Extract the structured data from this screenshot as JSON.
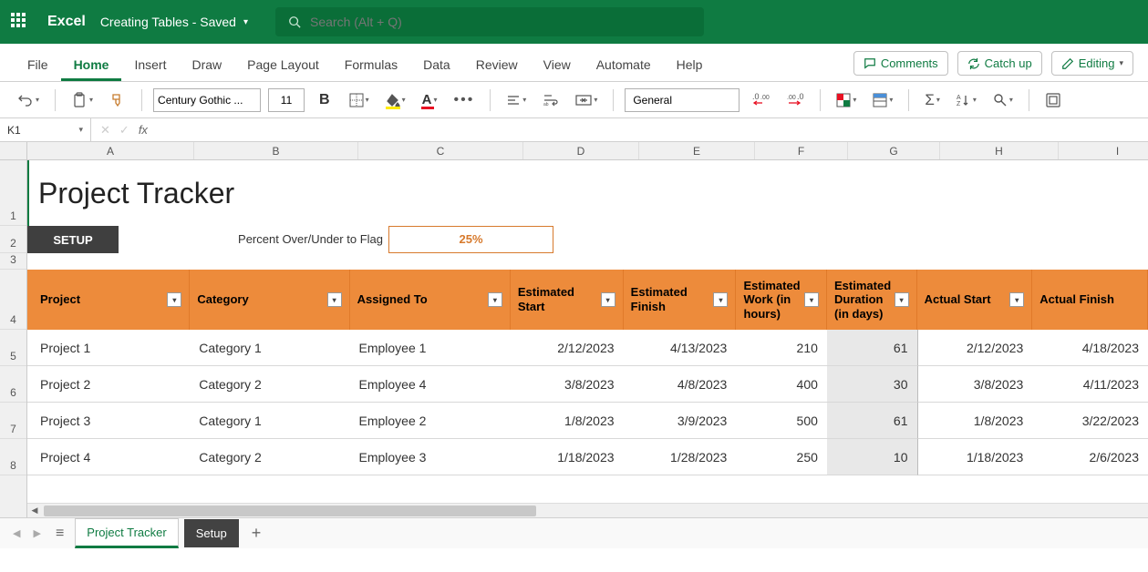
{
  "titlebar": {
    "app": "Excel",
    "doc": "Creating Tables - Saved",
    "search_placeholder": "Search (Alt + Q)"
  },
  "tabs": {
    "items": [
      "File",
      "Home",
      "Insert",
      "Draw",
      "Page Layout",
      "Formulas",
      "Data",
      "Review",
      "View",
      "Automate",
      "Help"
    ],
    "active": "Home",
    "comments": "Comments",
    "catchup": "Catch up",
    "editing": "Editing"
  },
  "ribbon": {
    "font_name": "Century Gothic ...",
    "font_size": "11",
    "number_format": "General"
  },
  "namebox": "K1",
  "columns": [
    "A",
    "B",
    "C",
    "D",
    "E",
    "F",
    "G",
    "H",
    "I"
  ],
  "rows": [
    "1",
    "2",
    "3",
    "4",
    "5",
    "6",
    "7",
    "8"
  ],
  "sheet": {
    "title": "Project Tracker",
    "setup": "SETUP",
    "flag_label": "Percent Over/Under to Flag",
    "flag_value": "25%"
  },
  "headers": [
    "Project",
    "Category",
    "Assigned To",
    "Estimated Start",
    "Estimated Finish",
    "Estimated Work (in hours)",
    "Estimated Duration (in days)",
    "Actual Start",
    "Actual Finish"
  ],
  "data_rows": [
    {
      "project": "Project 1",
      "category": "Category 1",
      "assigned": "Employee 1",
      "est_start": "2/12/2023",
      "est_finish": "4/13/2023",
      "work": "210",
      "dur": "61",
      "act_start": "2/12/2023",
      "act_finish": "4/18/2023"
    },
    {
      "project": "Project 2",
      "category": "Category 2",
      "assigned": "Employee 4",
      "est_start": "3/8/2023",
      "est_finish": "4/8/2023",
      "work": "400",
      "dur": "30",
      "act_start": "3/8/2023",
      "act_finish": "4/11/2023"
    },
    {
      "project": "Project 3",
      "category": "Category 1",
      "assigned": "Employee 2",
      "est_start": "1/8/2023",
      "est_finish": "3/9/2023",
      "work": "500",
      "dur": "61",
      "act_start": "1/8/2023",
      "act_finish": "3/22/2023"
    },
    {
      "project": "Project 4",
      "category": "Category 2",
      "assigned": "Employee 3",
      "est_start": "1/18/2023",
      "est_finish": "1/28/2023",
      "work": "250",
      "dur": "10",
      "act_start": "1/18/2023",
      "act_finish": "2/6/2023"
    }
  ],
  "sheet_tabs": {
    "active": "Project Tracker",
    "other": "Setup"
  }
}
